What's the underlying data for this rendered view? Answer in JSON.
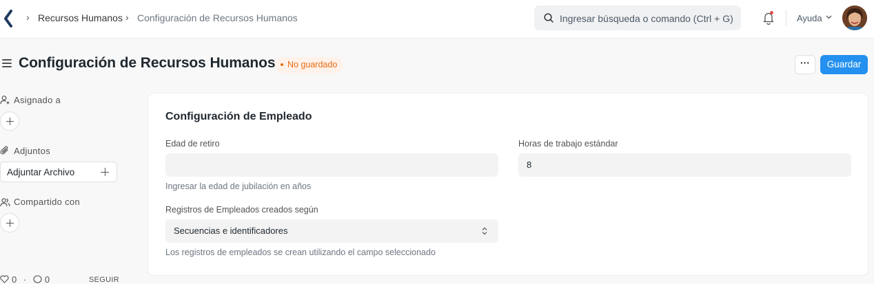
{
  "breadcrumbs": [
    {
      "label": "Recursos Humanos"
    },
    {
      "label": "Configuración de Recursos Humanos"
    }
  ],
  "search": {
    "placeholder": "Ingresar búsqueda o comando (Ctrl + G)"
  },
  "navbar": {
    "help_label": "Ayuda"
  },
  "page": {
    "title": "Configuración de Recursos Humanos",
    "status": "No guardado",
    "more_label": "···",
    "save_label": "Guardar"
  },
  "sidebar": {
    "assigned_label": "Asignado a",
    "attachments_label": "Adjuntos",
    "attach_file_label": "Adjuntar Archivo",
    "shared_label": "Compartido con",
    "likes_count": "0",
    "separator": "·",
    "comments_count": "0",
    "follow_label": "SEGUIR"
  },
  "form": {
    "section_title": "Configuración de Empleado",
    "retirement_age": {
      "label": "Edad de retiro",
      "value": "",
      "description": "Ingresar la edad de jubilación en años"
    },
    "standard_hours": {
      "label": "Horas de trabajo estándar",
      "value": "8"
    },
    "naming_by": {
      "label": "Registros de Empleados creados según",
      "value": "Secuencias e identificadores",
      "description": "Los registros de empleados se crean utilizando el campo seleccionado"
    }
  },
  "colors": {
    "primary": "#2490ef",
    "status_orange": "#e86c13",
    "status_bg": "#fff2ea"
  },
  "icons": [
    "back-logo-icon",
    "chevron-right-icon",
    "search-icon",
    "bell-icon",
    "chevron-down-icon",
    "menu-icon",
    "user-plus-icon",
    "paperclip-icon",
    "users-icon",
    "heart-icon",
    "comment-icon",
    "select-chevron-icon",
    "plus-icon"
  ]
}
